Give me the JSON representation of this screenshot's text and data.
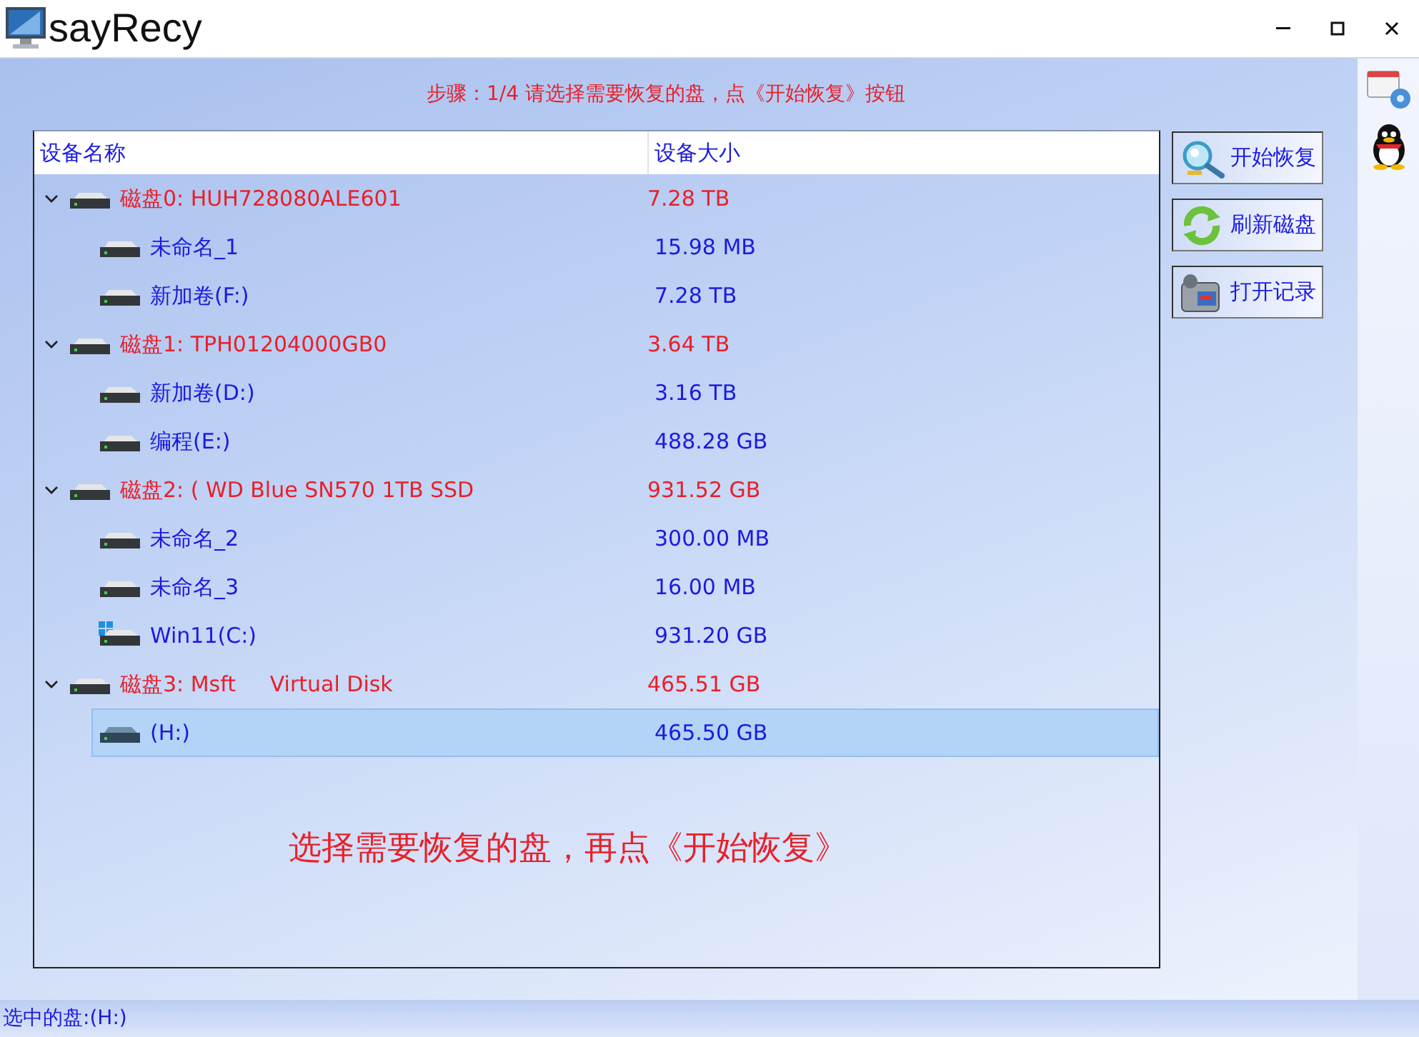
{
  "window": {
    "title": "sayRecy"
  },
  "step": "步骤：1/4 请选择需要恢复的盘，点《开始恢复》按钮",
  "table": {
    "columns": [
      "设备名称",
      "设备大小"
    ],
    "disks": [
      {
        "name": "磁盘0: HUH728080ALE601",
        "size": "7.28 TB",
        "expanded": true,
        "children": [
          {
            "name": "未命名_1",
            "size": "15.98 MB",
            "kind": "volume",
            "selected": false
          },
          {
            "name": "新加卷(F:)",
            "size": "7.28 TB",
            "kind": "volume",
            "selected": false
          }
        ]
      },
      {
        "name": "磁盘1: TPH01204000GB0",
        "size": "3.64 TB",
        "expanded": true,
        "children": [
          {
            "name": "新加卷(D:)",
            "size": "3.16 TB",
            "kind": "volume",
            "selected": false
          },
          {
            "name": "编程(E:)",
            "size": "488.28 GB",
            "kind": "volume",
            "selected": false
          }
        ]
      },
      {
        "name": "磁盘2: ( WD Blue SN570 1TB SSD",
        "size": "931.52 GB",
        "expanded": true,
        "children": [
          {
            "name": "未命名_2",
            "size": "300.00 MB",
            "kind": "volume",
            "selected": false
          },
          {
            "name": "未命名_3",
            "size": "16.00 MB",
            "kind": "volume",
            "selected": false
          },
          {
            "name": "Win11(C:)",
            "size": "931.20 GB",
            "kind": "system",
            "selected": false
          }
        ]
      },
      {
        "name": "磁盘3: Msft     Virtual Disk",
        "size": "465.51 GB",
        "expanded": true,
        "children": [
          {
            "name": "(H:)",
            "size": "465.50 GB",
            "kind": "volume",
            "selected": true
          }
        ]
      }
    ],
    "hint": "选择需要恢复的盘，再点《开始恢复》"
  },
  "buttons": [
    {
      "label": "开始恢复",
      "kind": "start"
    },
    {
      "label": "刷新磁盘",
      "kind": "refresh"
    },
    {
      "label": "打开记录",
      "kind": "log"
    }
  ],
  "status_bar": "选中的盘:(H:)"
}
